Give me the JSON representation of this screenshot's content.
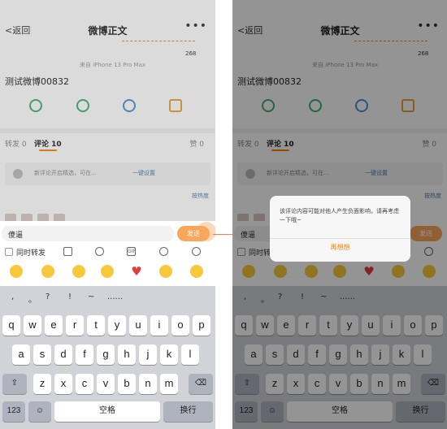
{
  "nav": {
    "back": "<返回",
    "title": "微博正文",
    "more": "•••"
  },
  "post": {
    "device": "来自 iPhone 13 Pro Max",
    "text": "测试微博00832",
    "annot_num": "268"
  },
  "tabs": {
    "repost": "转发 0",
    "comment": "评论 10",
    "like": "赞 0"
  },
  "notice": {
    "text": "新评论开启精选，可在…",
    "link": "一键设置"
  },
  "sort_link": "按热度",
  "input": {
    "value": "傻逼",
    "send": "发送"
  },
  "tools": {
    "forward_label": "同时转发",
    "gif": "GIF"
  },
  "popup": {
    "message": "该评论内容可能对他人产生负面影响，请再考虑一下哦~",
    "button": "再想想"
  },
  "keyboard": {
    "quick": [
      ",",
      "。",
      "?",
      "!",
      "~",
      "......"
    ],
    "row1": [
      "q",
      "w",
      "e",
      "r",
      "t",
      "y",
      "u",
      "i",
      "o",
      "p"
    ],
    "row2": [
      "a",
      "s",
      "d",
      "f",
      "g",
      "h",
      "j",
      "k",
      "l"
    ],
    "row3": [
      "z",
      "x",
      "c",
      "v",
      "b",
      "n",
      "m"
    ],
    "num_key": "123",
    "space": "空格",
    "return": "换行"
  },
  "colors": {
    "accent": "#ff8200",
    "link": "#507daf"
  }
}
